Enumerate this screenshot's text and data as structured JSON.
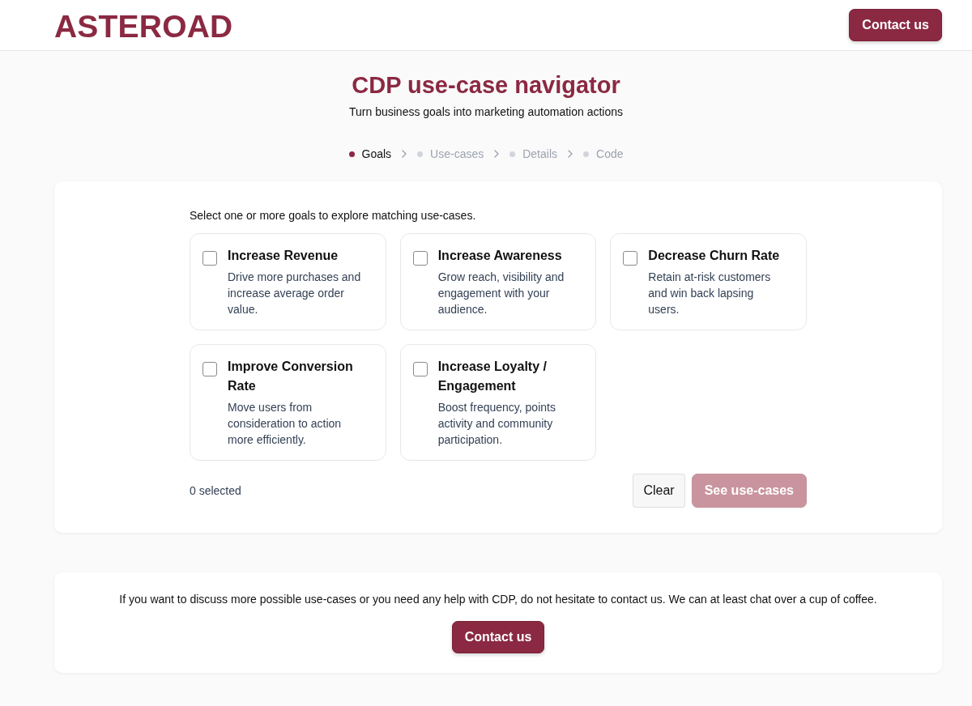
{
  "header": {
    "logo": "ASTEROAD",
    "contact_button": "Contact us"
  },
  "title": "CDP use-case navigator",
  "subtitle": "Turn business goals into marketing automation actions",
  "steps": [
    {
      "label": "Goals",
      "selected": true
    },
    {
      "label": "Use-cases",
      "selected": false
    },
    {
      "label": "Details",
      "selected": false
    },
    {
      "label": "Code",
      "selected": false
    }
  ],
  "goals_panel": {
    "prompt": "Select one or more goals to explore matching use-cases.",
    "goals": [
      {
        "title": "Increase Revenue",
        "description": "Drive more purchases and increase average order value.",
        "checked": false
      },
      {
        "title": "Increase Awareness",
        "description": "Grow reach, visibility and engagement with your audience.",
        "checked": false
      },
      {
        "title": "Decrease Churn Rate",
        "description": "Retain at-risk customers and win back lapsing users.",
        "checked": false
      },
      {
        "title": "Improve Conversion Rate",
        "description": "Move users from consideration to action more efficiently.",
        "checked": false
      },
      {
        "title": "Increase Loyalty / Engagement",
        "description": "Boost frequency, points activity and community participation.",
        "checked": false
      }
    ],
    "selection_count": "0 selected",
    "clear_button": "Clear",
    "submit_button": {
      "label": "See use-cases",
      "disabled": true
    }
  },
  "contact_panel": {
    "text": "If you want to discuss more possible use-cases or you need any help with CDP, do not hesitate to contact us. We can at least chat over a cup of coffee.",
    "button": "Contact us"
  }
}
